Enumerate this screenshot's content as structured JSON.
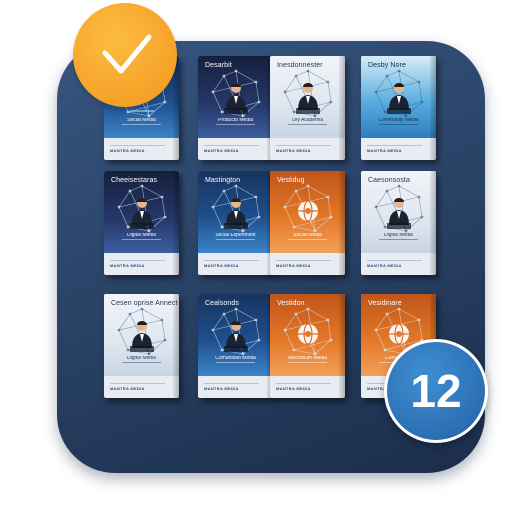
{
  "badge_count": "12",
  "icons": {
    "check": "checkmark-icon"
  },
  "colors": {
    "check_badge": "#f7a52b",
    "count_badge": "#2c6fb4",
    "panel": "#2a4468"
  },
  "cards": [
    {
      "title": "",
      "subtitle": "Social Media",
      "footer": "MANTRA MEDIA",
      "style": "blue",
      "art": "bird"
    },
    {
      "title": "Desarbit",
      "subtitle": "Producto Media",
      "footer": "MANTRA MEDIA",
      "style": "navy",
      "art": "person"
    },
    {
      "title": "Inesdonnester",
      "subtitle": "Ley Academia",
      "footer": "MANTRA MEDIA",
      "style": "light",
      "art": "person"
    },
    {
      "title": "Desby Nore",
      "subtitle": "Community Media",
      "footer": "MANTRA MEDIA",
      "style": "cyan",
      "art": "person"
    },
    {
      "title": "Cheeisestaras",
      "subtitle": "Digital Media",
      "footer": "MANTRA MEDIA",
      "style": "navy",
      "art": "person"
    },
    {
      "title": "Mastington",
      "subtitle": "Social Experiment",
      "footer": "MANTRA MEDIA",
      "style": "blue",
      "art": "person"
    },
    {
      "title": "Vestidug",
      "subtitle": "Social Media",
      "footer": "MANTRA MEDIA",
      "style": "orange",
      "art": "globe"
    },
    {
      "title": "Caesonsosta",
      "subtitle": "Digital Media",
      "footer": "MANTRA MEDIA",
      "style": "light",
      "art": "person"
    },
    {
      "title": "Cesen oprise Annect",
      "subtitle": "Digital Media",
      "footer": "MANTRA MEDIA",
      "style": "light",
      "art": "person"
    },
    {
      "title": "Cealsonds",
      "subtitle": "Comunidad Media",
      "footer": "MANTRA MEDIA",
      "style": "blue",
      "art": "person"
    },
    {
      "title": "Vestidon",
      "subtitle": "Neconsum Media",
      "footer": "MANTRA MEDIA",
      "style": "orange",
      "art": "globe"
    },
    {
      "title": "Vesidinare",
      "subtitle": "Caesmetico",
      "footer": "MANTRA MEDIA",
      "style": "orange",
      "art": "globe"
    }
  ]
}
